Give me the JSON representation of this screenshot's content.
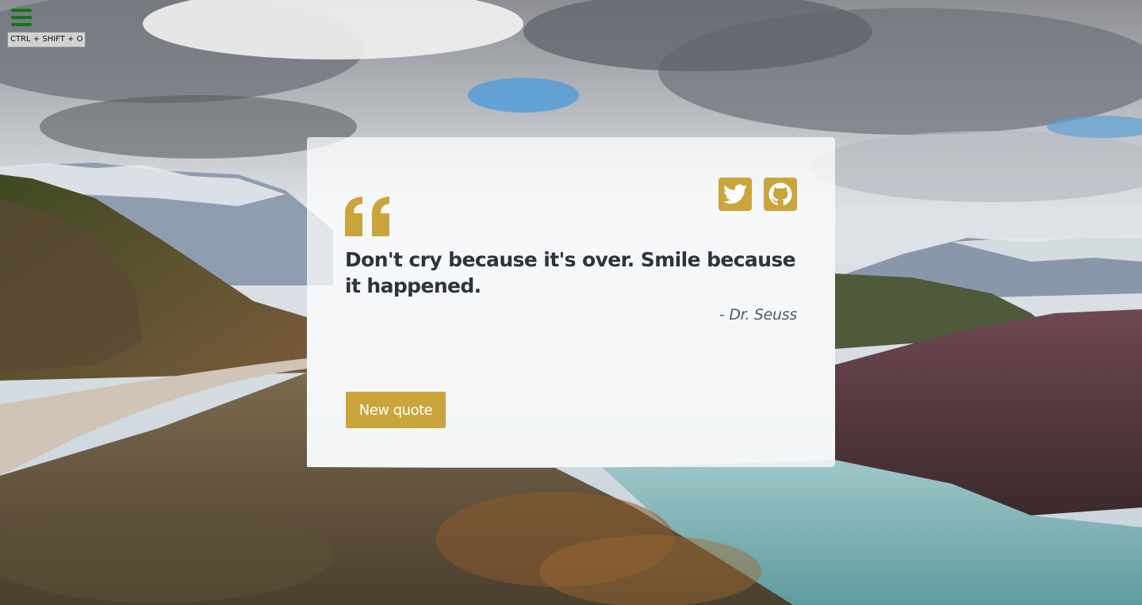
{
  "menu": {
    "icon": "hamburger-menu-icon",
    "shortcut": "CTRL + SHIFT + O",
    "color": "#0b7a13"
  },
  "quote": {
    "text": "Don't cry because it's over. Smile because it happened.",
    "author": "- Dr. Seuss",
    "new_quote_label": "New quote"
  },
  "social": {
    "twitter_icon": "twitter-bird-icon",
    "github_icon": "github-octocat-icon"
  },
  "theme": {
    "accent": "#c9a53c",
    "text": "#2f333a",
    "author_text": "#555a62"
  }
}
